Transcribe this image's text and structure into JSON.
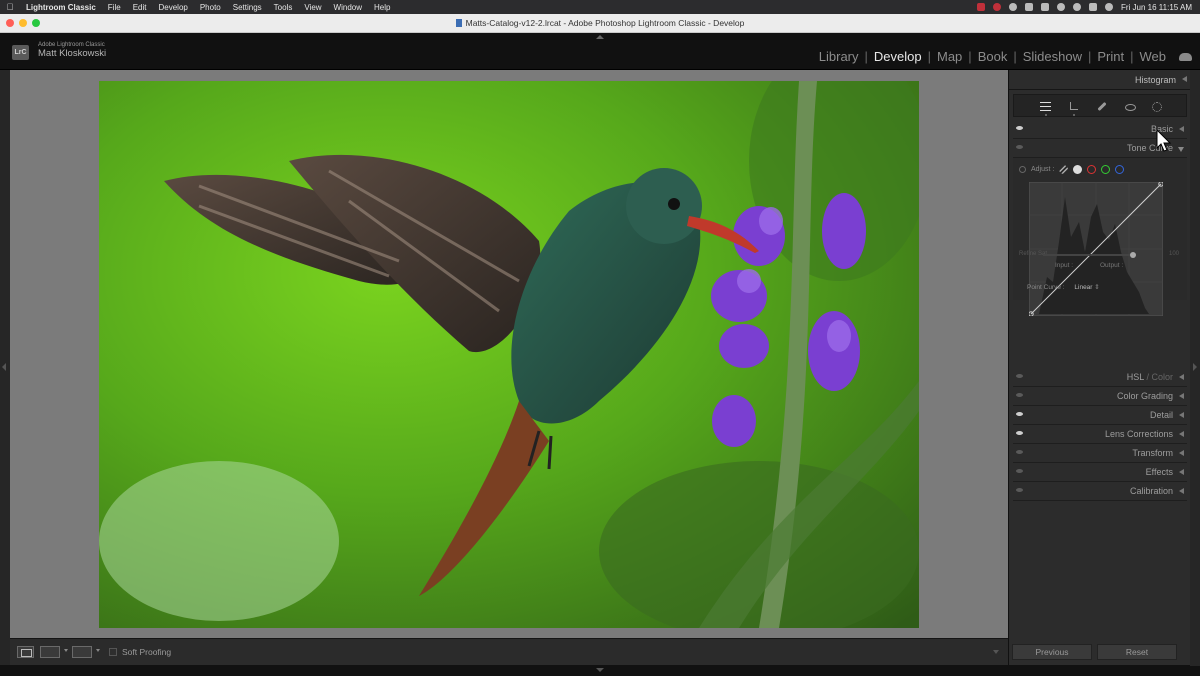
{
  "menubar": {
    "app_name": "Lightroom Classic",
    "items": [
      "File",
      "Edit",
      "Develop",
      "Photo",
      "Settings",
      "Tools",
      "View",
      "Window",
      "Help"
    ],
    "clock": "Fri Jun 16  11:15 AM"
  },
  "window": {
    "title": "Matts-Catalog-v12-2.lrcat - Adobe Photoshop Lightroom Classic - Develop"
  },
  "identity": {
    "badge": "LrC",
    "product": "Adobe Lightroom Classic",
    "user": "Matt Kloskowski"
  },
  "modules": [
    {
      "label": "Library",
      "active": false
    },
    {
      "label": "Develop",
      "active": true
    },
    {
      "label": "Map",
      "active": false
    },
    {
      "label": "Book",
      "active": false
    },
    {
      "label": "Slideshow",
      "active": false
    },
    {
      "label": "Print",
      "active": false
    },
    {
      "label": "Web",
      "active": false
    }
  ],
  "toolbar": {
    "yy_label": "",
    "soft_proofing": "Soft Proofing"
  },
  "right_panel": {
    "histogram": "Histogram",
    "sections": {
      "basic": "Basic",
      "tone_curve": "Tone Curve",
      "hsl_prefix": "HSL",
      "hsl_suffix": " / Color",
      "color_grading": "Color Grading",
      "detail": "Detail",
      "lens_corrections": "Lens Corrections",
      "transform": "Transform",
      "effects": "Effects",
      "calibration": "Calibration"
    },
    "tone_curve": {
      "adjust_label": "Adjust :",
      "refine_label": "Refine Sat.",
      "refine_value": "100",
      "input_label": "Input :",
      "output_label": "Output :",
      "point_curve_label": "Point Curve :",
      "point_curve_value": "Linear"
    },
    "previous_button": "Previous",
    "reset_button": "Reset"
  },
  "icons": {
    "apple": "apple-icon",
    "cloud": "cloud-sync-icon",
    "cursor": "mouse-pointer-icon"
  },
  "colors": {
    "panel_bg": "#2c2c2c",
    "canvas_bg": "#7b7b7b",
    "active_module": "#e8e8e8",
    "inactive_module": "#8c8c8c"
  }
}
